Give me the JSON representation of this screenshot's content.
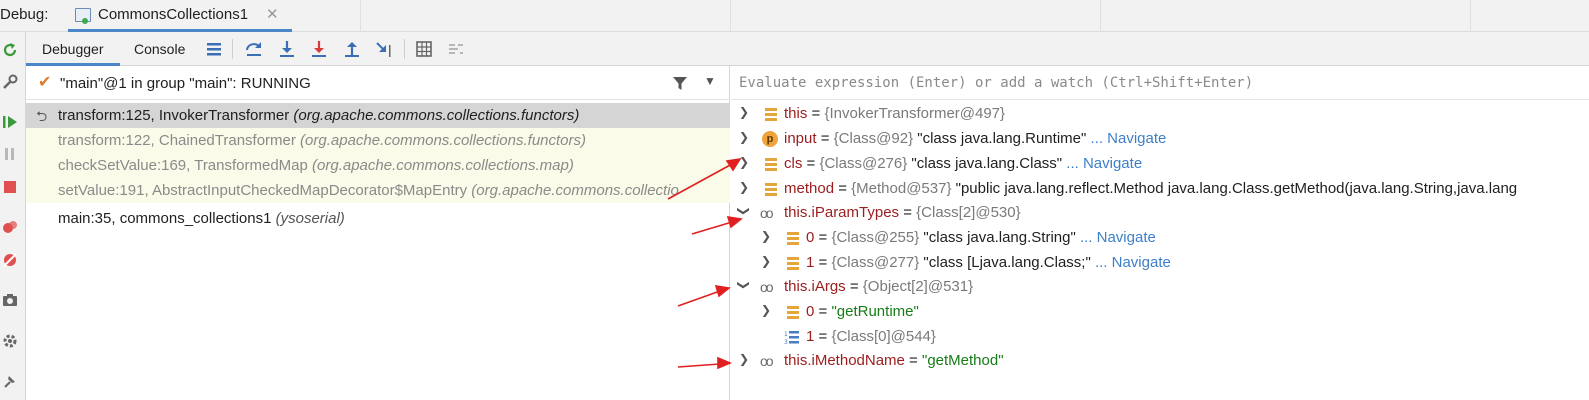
{
  "titlebar": {
    "label": "Debug:",
    "tab_title": "CommonsCollections1",
    "tab_close": "✕"
  },
  "toolbar": {
    "debugger_tab": "Debugger",
    "console_tab": "Console"
  },
  "thread": {
    "text": "\"main\"@1 in group \"main\": RUNNING"
  },
  "frames": [
    {
      "method": "transform:125, InvokerTransformer ",
      "pkg": "(org.apache.commons.collections.functors)"
    },
    {
      "method": "transform:122, ChainedTransformer ",
      "pkg": "(org.apache.commons.collections.functors)"
    },
    {
      "method": "checkSetValue:169, TransformedMap ",
      "pkg": "(org.apache.commons.collections.map)"
    },
    {
      "method": "setValue:191, AbstractInputCheckedMapDecorator$MapEntry ",
      "pkg": "(org.apache.commons.collectio"
    },
    {
      "method": "main:35, commons_collections1 ",
      "pkg": "(ysoserial)"
    }
  ],
  "eval": {
    "placeholder": "Evaluate expression (Enter) or add a watch (Ctrl+Shift+Enter)"
  },
  "variables": [
    {
      "name": "this",
      "eq": " = ",
      "ref": "{InvokerTransformer@497}",
      "str": "",
      "nav": ""
    },
    {
      "name": "input",
      "eq": " = ",
      "ref": "{Class@92} ",
      "str": "\"class java.lang.Runtime\"",
      "nav": " ... Navigate"
    },
    {
      "name": "cls",
      "eq": " = ",
      "ref": "{Class@276} ",
      "str": "\"class java.lang.Class\"",
      "nav": " ... Navigate"
    },
    {
      "name": "method",
      "eq": " = ",
      "ref": "{Method@537} ",
      "str": "\"public java.lang.reflect.Method java.lang.Class.getMethod(java.lang.String,java.lang",
      "nav": ""
    },
    {
      "name": "this.iParamTypes",
      "eq": " = ",
      "ref": "{Class[2]@530}",
      "str": "",
      "nav": ""
    },
    {
      "name": "0",
      "eq": " = ",
      "ref": "{Class@255} ",
      "str": "\"class java.lang.String\"",
      "nav": " ... Navigate"
    },
    {
      "name": "1",
      "eq": " = ",
      "ref": "{Class@277} ",
      "str": "\"class [Ljava.lang.Class;\"",
      "nav": " ... Navigate"
    },
    {
      "name": "this.iArgs",
      "eq": " = ",
      "ref": "{Object[2]@531}",
      "str": "",
      "nav": ""
    },
    {
      "name": "0",
      "eq": " = ",
      "ref": "",
      "str": "\"getRuntime\"",
      "nav": ""
    },
    {
      "name": "1",
      "eq": " = ",
      "ref": "{Class[0]@544}",
      "str": "",
      "nav": ""
    },
    {
      "name": "this.iMethodName",
      "eq": " = ",
      "ref": "",
      "str": "\"getMethod\"",
      "nav": ""
    }
  ],
  "icons": {
    "tab": "debug-config-icon",
    "field": "field-icon",
    "param": "parameter-icon",
    "watch": "watch-icon",
    "array": "array-icon"
  },
  "colors": {
    "accent": "#4a86c8",
    "annotation": "#e02020",
    "string": "#167c16",
    "navigate": "#3e7fc9"
  }
}
